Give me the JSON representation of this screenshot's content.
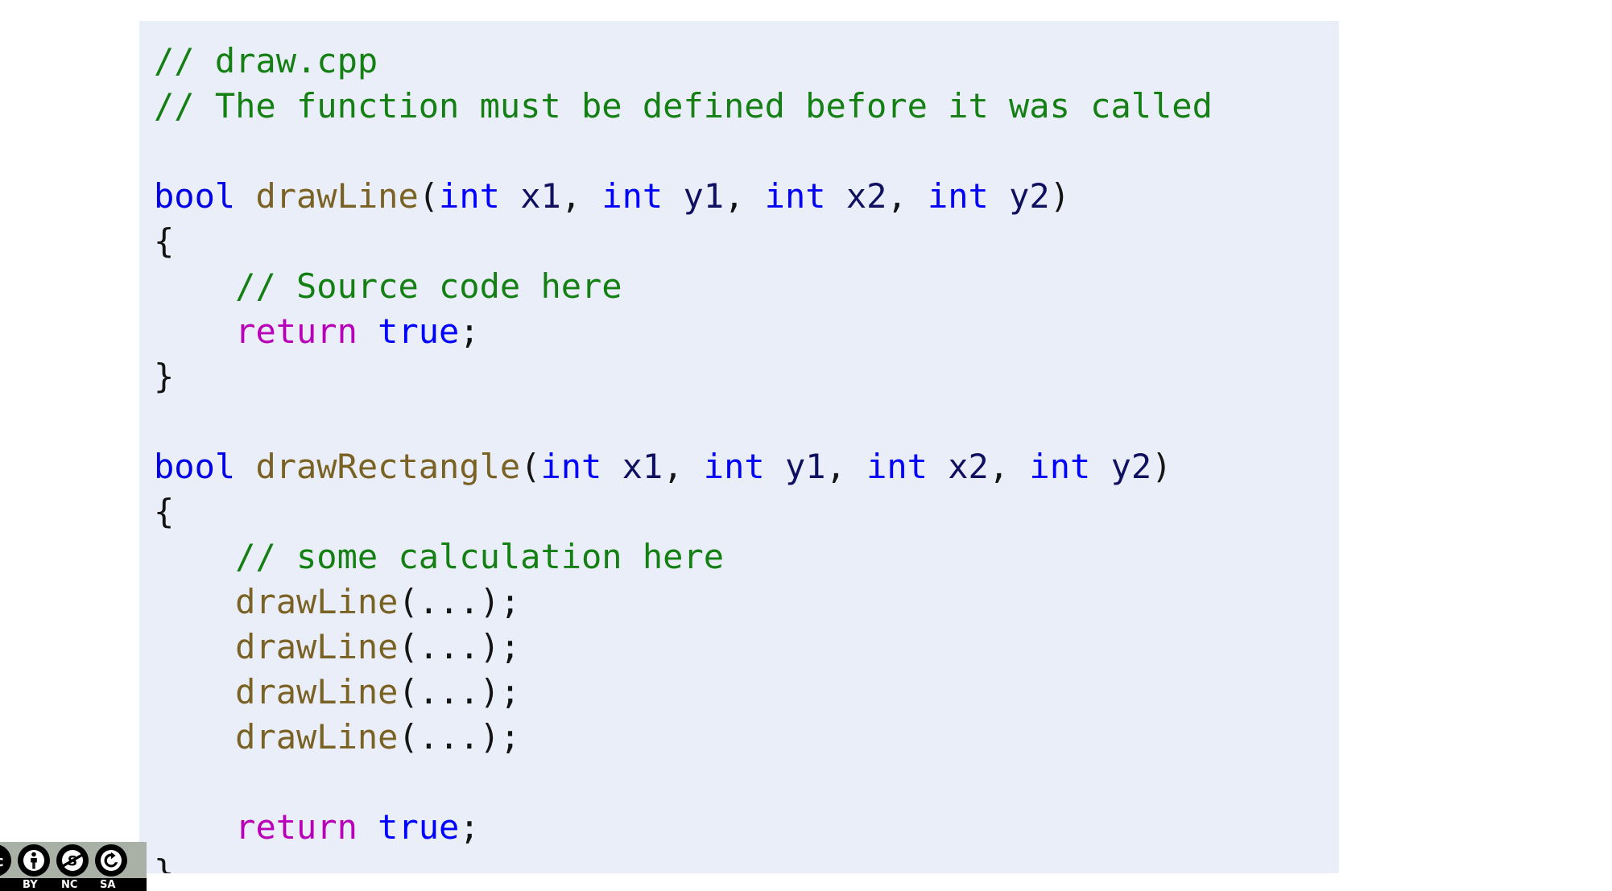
{
  "slide": {
    "background_color": "#ffffff",
    "code_block": {
      "background_color": "#eaeef8",
      "language": "cpp",
      "filename": "draw.cpp",
      "lines": [
        {
          "indent": 0,
          "tokens": [
            {
              "text": "// draw.cpp",
              "cls": "t-comment"
            }
          ]
        },
        {
          "indent": 0,
          "tokens": [
            {
              "text": "// The function must be defined before it was called",
              "cls": "t-comment"
            }
          ]
        },
        {
          "indent": 0,
          "tokens": [
            {
              "text": "",
              "cls": "t-punct"
            }
          ]
        },
        {
          "indent": 0,
          "tokens": [
            {
              "text": "bool",
              "cls": "t-keyword"
            },
            {
              "text": " ",
              "cls": "t-punct"
            },
            {
              "text": "drawLine",
              "cls": "t-func"
            },
            {
              "text": "(",
              "cls": "t-punct"
            },
            {
              "text": "int",
              "cls": "t-type"
            },
            {
              "text": " ",
              "cls": "t-punct"
            },
            {
              "text": "x1",
              "cls": "t-ident"
            },
            {
              "text": ", ",
              "cls": "t-punct"
            },
            {
              "text": "int",
              "cls": "t-type"
            },
            {
              "text": " ",
              "cls": "t-punct"
            },
            {
              "text": "y1",
              "cls": "t-ident"
            },
            {
              "text": ", ",
              "cls": "t-punct"
            },
            {
              "text": "int",
              "cls": "t-type"
            },
            {
              "text": " ",
              "cls": "t-punct"
            },
            {
              "text": "x2",
              "cls": "t-ident"
            },
            {
              "text": ", ",
              "cls": "t-punct"
            },
            {
              "text": "int",
              "cls": "t-type"
            },
            {
              "text": " ",
              "cls": "t-punct"
            },
            {
              "text": "y2",
              "cls": "t-ident"
            },
            {
              "text": ")",
              "cls": "t-punct"
            }
          ]
        },
        {
          "indent": 0,
          "tokens": [
            {
              "text": "{",
              "cls": "t-brace"
            }
          ]
        },
        {
          "indent": 4,
          "tokens": [
            {
              "text": "// Source code here",
              "cls": "t-comment"
            }
          ]
        },
        {
          "indent": 4,
          "tokens": [
            {
              "text": "return",
              "cls": "t-return"
            },
            {
              "text": " ",
              "cls": "t-punct"
            },
            {
              "text": "true",
              "cls": "t-bool"
            },
            {
              "text": ";",
              "cls": "t-punct"
            }
          ]
        },
        {
          "indent": 0,
          "tokens": [
            {
              "text": "}",
              "cls": "t-brace"
            }
          ]
        },
        {
          "indent": 0,
          "tokens": [
            {
              "text": "",
              "cls": "t-punct"
            }
          ]
        },
        {
          "indent": 0,
          "tokens": [
            {
              "text": "bool",
              "cls": "t-keyword"
            },
            {
              "text": " ",
              "cls": "t-punct"
            },
            {
              "text": "drawRectangle",
              "cls": "t-func"
            },
            {
              "text": "(",
              "cls": "t-punct"
            },
            {
              "text": "int",
              "cls": "t-type"
            },
            {
              "text": " ",
              "cls": "t-punct"
            },
            {
              "text": "x1",
              "cls": "t-ident"
            },
            {
              "text": ", ",
              "cls": "t-punct"
            },
            {
              "text": "int",
              "cls": "t-type"
            },
            {
              "text": " ",
              "cls": "t-punct"
            },
            {
              "text": "y1",
              "cls": "t-ident"
            },
            {
              "text": ", ",
              "cls": "t-punct"
            },
            {
              "text": "int",
              "cls": "t-type"
            },
            {
              "text": " ",
              "cls": "t-punct"
            },
            {
              "text": "x2",
              "cls": "t-ident"
            },
            {
              "text": ", ",
              "cls": "t-punct"
            },
            {
              "text": "int",
              "cls": "t-type"
            },
            {
              "text": " ",
              "cls": "t-punct"
            },
            {
              "text": "y2",
              "cls": "t-ident"
            },
            {
              "text": ")",
              "cls": "t-punct"
            }
          ]
        },
        {
          "indent": 0,
          "tokens": [
            {
              "text": "{",
              "cls": "t-brace"
            }
          ]
        },
        {
          "indent": 4,
          "tokens": [
            {
              "text": "// some calculation here",
              "cls": "t-comment"
            }
          ]
        },
        {
          "indent": 4,
          "tokens": [
            {
              "text": "drawLine",
              "cls": "t-func"
            },
            {
              "text": "(...);",
              "cls": "t-punct"
            }
          ]
        },
        {
          "indent": 4,
          "tokens": [
            {
              "text": "drawLine",
              "cls": "t-func"
            },
            {
              "text": "(...);",
              "cls": "t-punct"
            }
          ]
        },
        {
          "indent": 4,
          "tokens": [
            {
              "text": "drawLine",
              "cls": "t-func"
            },
            {
              "text": "(...);",
              "cls": "t-punct"
            }
          ]
        },
        {
          "indent": 4,
          "tokens": [
            {
              "text": "drawLine",
              "cls": "t-func"
            },
            {
              "text": "(...);",
              "cls": "t-punct"
            }
          ]
        },
        {
          "indent": 0,
          "tokens": [
            {
              "text": "",
              "cls": "t-punct"
            }
          ]
        },
        {
          "indent": 4,
          "tokens": [
            {
              "text": "return",
              "cls": "t-return"
            },
            {
              "text": " ",
              "cls": "t-punct"
            },
            {
              "text": "true",
              "cls": "t-bool"
            },
            {
              "text": ";",
              "cls": "t-punct"
            }
          ]
        },
        {
          "indent": 0,
          "tokens": [
            {
              "text": "}",
              "cls": "t-brace"
            }
          ]
        }
      ],
      "plain_text": "// draw.cpp\n// The function must be defined before it was called\n\nbool drawLine(int x1, int y1, int x2, int y2)\n{\n    // Source code here\n    return true;\n}\n\nbool drawRectangle(int x1, int y1, int x2, int y2)\n{\n    // some calculation here\n    drawLine(...);\n    drawLine(...);\n    drawLine(...);\n    drawLine(...);\n\n    return true;\n}"
    },
    "license_badge": {
      "name": "cc-by-nc-sa-badge",
      "prefix": "cc",
      "terms": [
        "BY",
        "NC",
        "SA"
      ],
      "icons": [
        "creative-commons-icon",
        "attribution-person-icon",
        "non-commercial-dollar-icon",
        "share-alike-icon"
      ],
      "band_color": "#a9b0a6",
      "bar_color": "#000000"
    },
    "syntax_colors": {
      "comment": "#148014",
      "keyword": "#0000e6",
      "type": "#0000ff",
      "function": "#7a6224",
      "return_keyword": "#b800b8",
      "boolean": "#0000ff",
      "identifier": "#101060",
      "punctuation": "#141414"
    }
  }
}
